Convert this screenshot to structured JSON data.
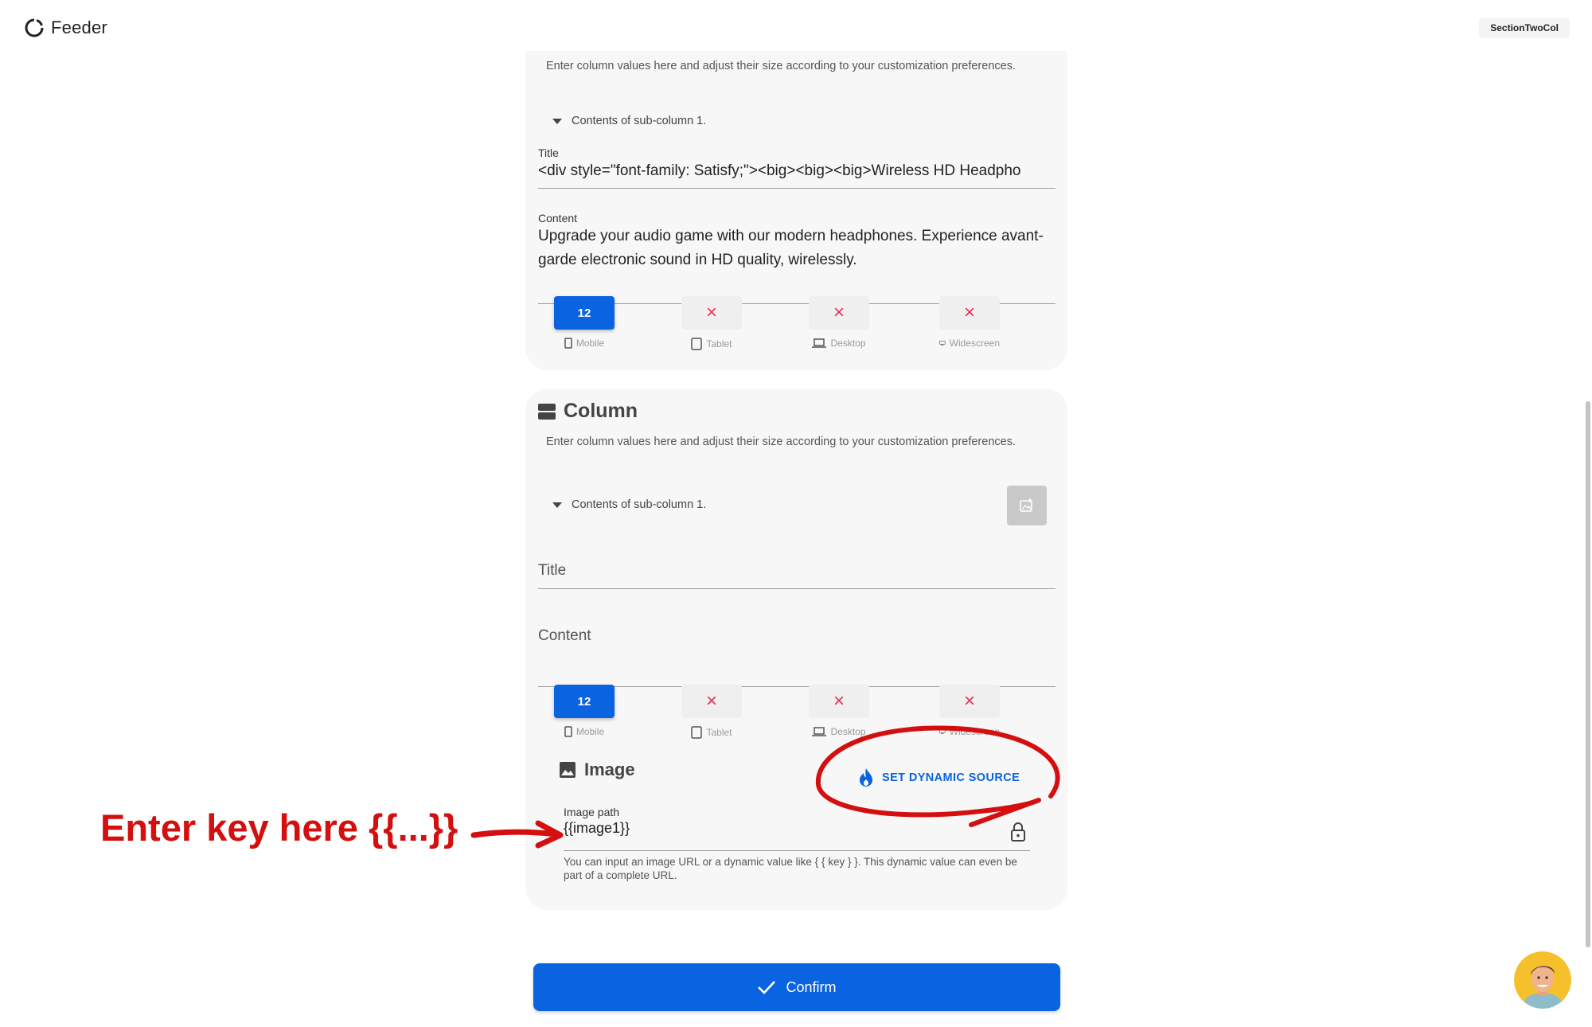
{
  "app": {
    "name": "Feeder",
    "section_chip": "SectionTwoCol"
  },
  "card1": {
    "description": "Enter column values here and adjust their size according to your customization preferences.",
    "subcolumn_toggle": "Contents of sub-column 1.",
    "title_label": "Title",
    "title_value": "<div style=\"font-family: Satisfy;\"><big><big><big>Wireless HD Headpho",
    "content_label": "Content",
    "content_value": "Upgrade your audio game with our modern headphones. Experience avant-garde electronic sound in HD quality, wirelessly.",
    "sizes": [
      {
        "label": "Mobile",
        "value": "12",
        "active": true
      },
      {
        "label": "Tablet",
        "value": "×",
        "active": false
      },
      {
        "label": "Desktop",
        "value": "×",
        "active": false
      },
      {
        "label": "Widescreen",
        "value": "×",
        "active": false
      }
    ]
  },
  "card2": {
    "heading": "Column",
    "description": "Enter column values here and adjust their size according to your customization preferences.",
    "subcolumn_toggle": "Contents of sub-column 1.",
    "title_placeholder": "Title",
    "content_placeholder": "Content",
    "sizes": [
      {
        "label": "Mobile",
        "value": "12",
        "active": true
      },
      {
        "label": "Tablet",
        "value": "×",
        "active": false
      },
      {
        "label": "Desktop",
        "value": "×",
        "active": false
      },
      {
        "label": "Widescreen",
        "value": "×",
        "active": false
      }
    ],
    "image_heading": "Image",
    "dynamic_source_button": "SET DYNAMIC SOURCE",
    "image_path_label": "Image path",
    "image_path_value": "{{image1}}",
    "image_path_helper": "You can input an image URL or a dynamic value like { { key } }. This dynamic value can even be part of a complete URL."
  },
  "confirm_button": "Confirm",
  "annotation": {
    "text": "Enter key here {{...}}",
    "color": "#d40f0f"
  },
  "colors": {
    "primary": "#0a63e0",
    "danger": "#e6325a",
    "card_bg": "#f7f7f7"
  }
}
